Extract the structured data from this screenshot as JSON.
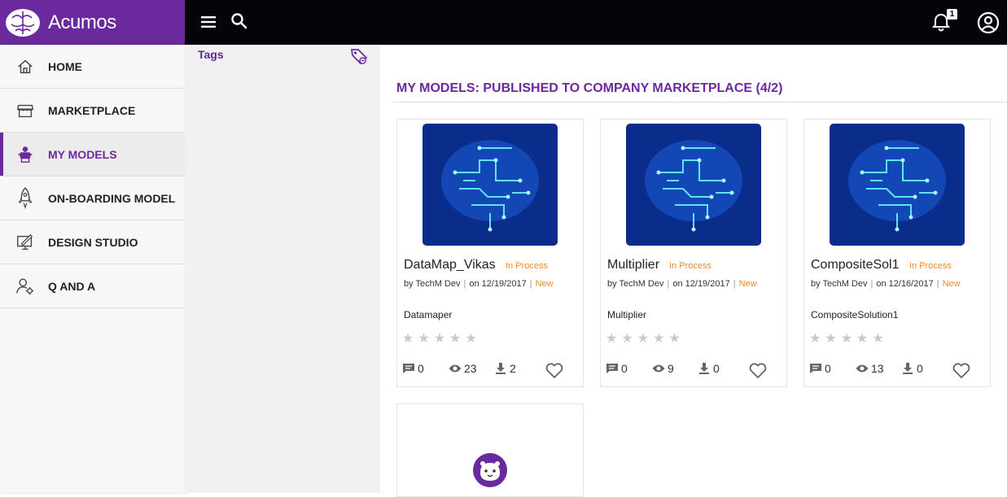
{
  "app": {
    "name": "Acumos",
    "brand_color": "#6a2a9e"
  },
  "header": {
    "menu_icon": "hamburger-icon",
    "search_icon": "search-icon",
    "notification_count": "1",
    "user_icon": "user-circle-icon"
  },
  "sidebar": {
    "items": [
      {
        "label": "HOME",
        "icon": "home-icon"
      },
      {
        "label": "MARKETPLACE",
        "icon": "store-icon"
      },
      {
        "label": "MY MODELS",
        "icon": "robot-icon",
        "active": true
      },
      {
        "label": "ON-BOARDING MODEL",
        "icon": "rocket-icon"
      },
      {
        "label": "DESIGN STUDIO",
        "icon": "design-icon"
      },
      {
        "label": "Q AND A",
        "icon": "user-settings-icon"
      }
    ]
  },
  "filter": {
    "tags_label": "Tags"
  },
  "main": {
    "section_title": "MY MODELS: PUBLISHED TO COMPANY MARKETPLACE (4/2)",
    "cards": [
      {
        "title": "DataMap_Vikas",
        "status": "In Process",
        "author": "by TechM Dev",
        "date": "on 12/19/2017",
        "tag": "New",
        "description": "Datamaper",
        "comments": "0",
        "views": "23",
        "downloads": "2"
      },
      {
        "title": "Multiplier",
        "status": "In Process",
        "author": "by TechM Dev",
        "date": "on 12/19/2017",
        "tag": "New",
        "description": "Multiplier",
        "comments": "0",
        "views": "9",
        "downloads": "0"
      },
      {
        "title": "CompositeSol1",
        "status": "In Process",
        "author": "by TechM Dev",
        "date": "on 12/16/2017",
        "tag": "New",
        "description": "CompositeSolution1",
        "comments": "0",
        "views": "13",
        "downloads": "0"
      }
    ]
  }
}
